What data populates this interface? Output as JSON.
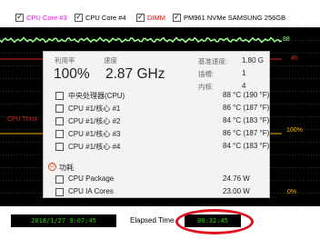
{
  "legend": {
    "items": [
      {
        "label": "CPU Core #3",
        "checked": true,
        "color": "#ff00ff"
      },
      {
        "label": "CPU Core #4",
        "checked": true,
        "color": "#ffffff"
      },
      {
        "label": "DIMM",
        "checked": true,
        "color": "#ff0000"
      },
      {
        "label": "PM961 NVMe SAMSUNG 256GB",
        "checked": true,
        "color": "#ffffff"
      }
    ],
    "check_glyph": "✓"
  },
  "graph": {
    "label_left": "CPU Throt",
    "label_r88": "88",
    "label_r45": "45",
    "label_r100": "100%",
    "label_r0": "0%",
    "colors": {
      "background": "#000000",
      "grid": "#3f8f3f",
      "trace_top": "#9fff8f",
      "trace_red": "#e02020",
      "trace_yellow": "#ffb000",
      "label_red": "#e02020"
    }
  },
  "popup": {
    "usage_label": "利用率",
    "speed_label": "速度",
    "usage_value": "100%",
    "speed_value": "2.87 GHz",
    "base_speed_label": "基准速度:",
    "base_speed_value": "1.80 G",
    "sockets_label": "插槽:",
    "sockets_value": "1",
    "cores_label": "内核:",
    "cores_value": "4",
    "temperature_rows": [
      {
        "name": "中央处理器(CPU)",
        "value": "88 °C  (190 °F)"
      },
      {
        "name": "CPU #1/核心 #1",
        "value": "86 °C  (187 °F)"
      },
      {
        "name": "CPU #1/核心 #2",
        "value": "84 °C  (183 °F)"
      },
      {
        "name": "CPU #1/核心 #3",
        "value": "86 °C  (187 °F)"
      },
      {
        "name": "CPU #1/核心 #4",
        "value": "84 °C  (183 °F)"
      }
    ],
    "power_heading": "功耗",
    "power_icon": "power-icon",
    "power_rows": [
      {
        "name": "CPU Package",
        "value": "24.76 W"
      },
      {
        "name": "CPU IA Cores",
        "value": "23.00 W"
      }
    ]
  },
  "status": {
    "datetime": "2018/1/27 9:07:45",
    "elapsed_label": "Elapsed Time",
    "elapsed_value": "00:32:45",
    "highlight_color": "#e01020"
  }
}
